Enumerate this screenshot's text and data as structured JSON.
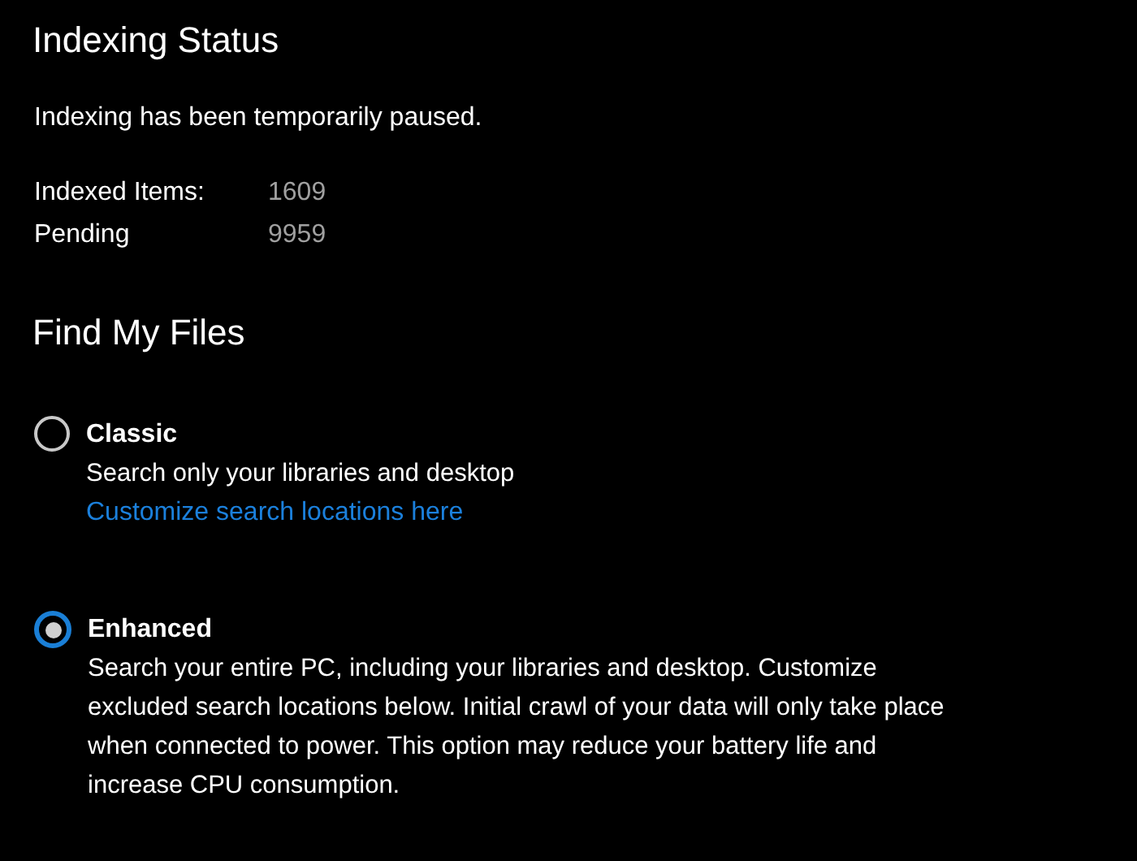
{
  "indexing_status": {
    "title": "Indexing Status",
    "message": "Indexing has been temporarily paused.",
    "stats": [
      {
        "label": "Indexed Items:",
        "value": "1609"
      },
      {
        "label": "Pending",
        "value": "9959"
      }
    ]
  },
  "find_my_files": {
    "title": "Find My Files",
    "options": [
      {
        "label": "Classic",
        "selected": false,
        "description": "Search only your libraries and desktop",
        "link": "Customize search locations here"
      },
      {
        "label": "Enhanced",
        "selected": true,
        "description": "Search your entire PC, including your libraries and desktop. Customize excluded search locations below. Initial crawl of your data will only take place when connected to power. This option may reduce your battery life and increase CPU consumption."
      }
    ]
  }
}
